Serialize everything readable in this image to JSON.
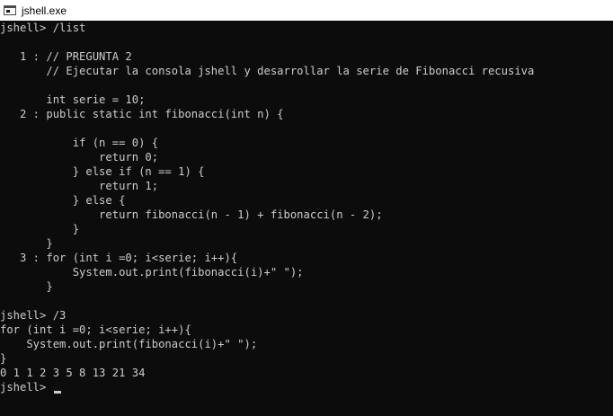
{
  "window": {
    "title": "jshell.exe",
    "icon": "console-window-icon"
  },
  "console": {
    "lines": [
      "jshell> /list",
      "",
      "   1 : // PREGUNTA 2",
      "       // Ejecutar la consola jshell y desarrollar la serie de Fibonacci recusiva",
      "",
      "       int serie = 10;",
      "   2 : public static int fibonacci(int n) {",
      "",
      "           if (n == 0) {",
      "               return 0;",
      "           } else if (n == 1) {",
      "               return 1;",
      "           } else {",
      "               return fibonacci(n - 1) + fibonacci(n - 2);",
      "           }",
      "       }",
      "   3 : for (int i =0; i<serie; i++){",
      "           System.out.print(fibonacci(i)+\" \");",
      "       }",
      "",
      "jshell> /3",
      "for (int i =0; i<serie; i++){",
      "    System.out.print(fibonacci(i)+\" \");",
      "}",
      "0 1 1 2 3 5 8 13 21 34"
    ],
    "current_prompt": "jshell> "
  },
  "colors": {
    "console_background": "#0c0c0c",
    "console_text": "#cccccc",
    "titlebar_background": "#ffffff"
  }
}
